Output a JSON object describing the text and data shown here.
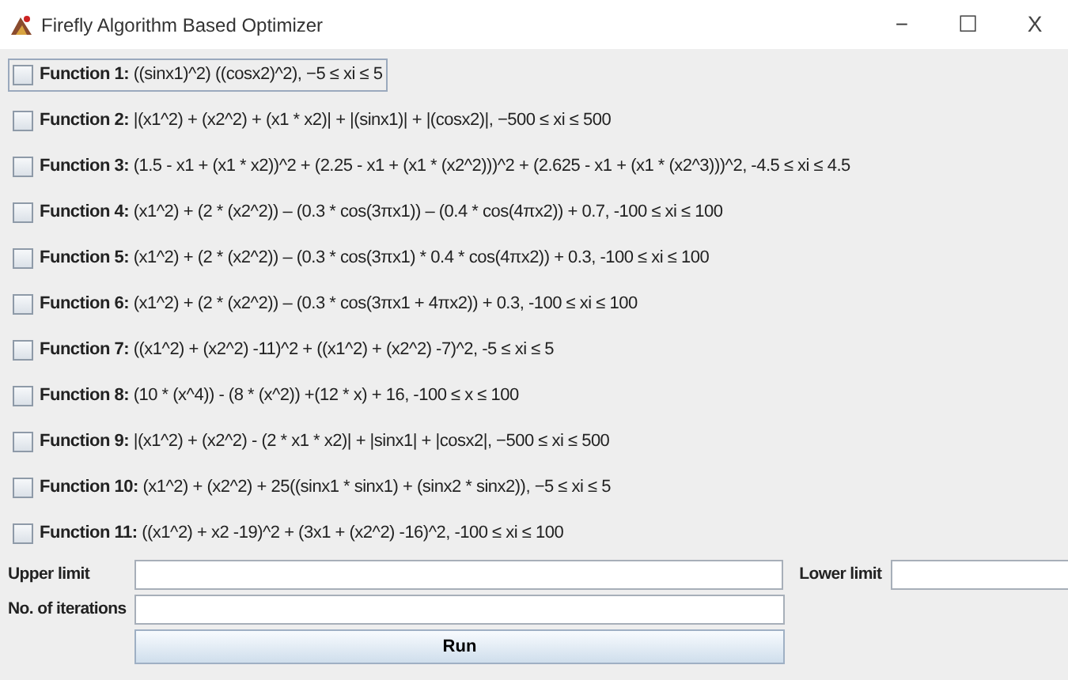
{
  "window": {
    "title": "Firefly Algorithm Based Optimizer",
    "controls": [
      "−",
      "☐",
      "X"
    ]
  },
  "functions": [
    {
      "label": "**Function 1:** ((sinx1)^2) ((cosx2)^2), −5 ≤ xi ≤ 5",
      "checked": false,
      "focused": true
    },
    {
      "label": "**Function 2:** |(x1^2) + (x2^2) + (x1 * x2)| + |(sinx1)| + |(cosx2)|, −500 ≤ xi ≤ 500",
      "checked": false,
      "focused": false
    },
    {
      "label": "**Function 3:** (1.5 - x1 + (x1 * x2))^2 + (2.25 - x1 + (x1 * (x2^2)))^2 + (2.625 - x1 + (x1 * (x2^3)))^2, -4.5 ≤ xi ≤ 4.5",
      "checked": false,
      "focused": false
    },
    {
      "label": "**Function 4:** (x1^2) + (2 * (x2^2)) – (0.3 * cos(3πx1)) – (0.4 * cos(4πx2)) + 0.7, -100 ≤ xi ≤ 100",
      "checked": false,
      "focused": false
    },
    {
      "label": "**Function 5:** (x1^2) + (2 * (x2^2)) – (0.3 * cos(3πx1) * 0.4 * cos(4πx2)) + 0.3, -100 ≤ xi ≤ 100",
      "checked": false,
      "focused": false
    },
    {
      "label": "**Function 6:** (x1^2) + (2 * (x2^2)) – (0.3 * cos(3πx1 + 4πx2)) + 0.3, -100 ≤ xi ≤ 100",
      "checked": false,
      "focused": false
    },
    {
      "label": "**Function 7:** ((x1^2) + (x2^2) -11)^2 + ((x1^2) + (x2^2) -7)^2, -5 ≤ xi ≤ 5",
      "checked": false,
      "focused": false
    },
    {
      "label": "**Function 8:** (10 * (x^4)) - (8 * (x^2)) +(12 * x) + 16, -100 ≤ x ≤ 100",
      "checked": false,
      "focused": false
    },
    {
      "label": "**Function 9:** |(x1^2) + (x2^2) - (2 * x1 * x2)| + |sinx1| + |cosx2|, −500 ≤ xi ≤ 500",
      "checked": false,
      "focused": false
    },
    {
      "label": "**Function 10:** (x1^2) + (x2^2) + 25((sinx1 * sinx1) + (sinx2 * sinx2)), −5 ≤ xi ≤ 5",
      "checked": false,
      "focused": false
    },
    {
      "label": "**Function 11:** ((x1^2) + x2 -19)^2 + (3x1 + (x2^2) -16)^2, -100 ≤ xi ≤ 100",
      "checked": false,
      "focused": false
    }
  ],
  "upper_limit": {
    "label": "Upper limit"
  },
  "lower_limit": {
    "label": "Lower limit"
  },
  "iterations": {
    "label": "No. of iterations"
  },
  "run_button": "Run"
}
